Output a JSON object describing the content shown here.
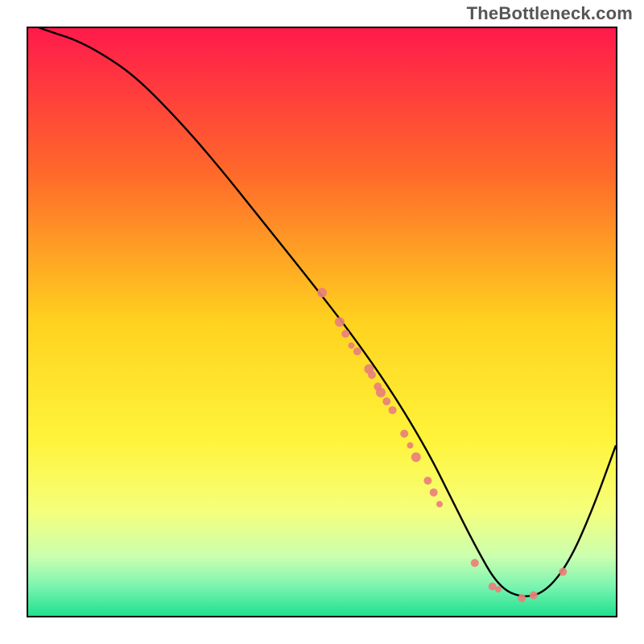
{
  "attribution": "TheBottleneck.com",
  "chart_data": {
    "type": "line",
    "title": "",
    "xlabel": "",
    "ylabel": "",
    "xlim": [
      0,
      100
    ],
    "ylim": [
      0,
      100
    ],
    "gradient_stops": [
      {
        "offset": 0.0,
        "color": "#ff1a4b"
      },
      {
        "offset": 0.25,
        "color": "#ff6a2a"
      },
      {
        "offset": 0.5,
        "color": "#ffd21f"
      },
      {
        "offset": 0.7,
        "color": "#fff43a"
      },
      {
        "offset": 0.82,
        "color": "#f5ff7a"
      },
      {
        "offset": 0.9,
        "color": "#caffb0"
      },
      {
        "offset": 0.95,
        "color": "#7af4b0"
      },
      {
        "offset": 1.0,
        "color": "#1fe08f"
      }
    ],
    "series": [
      {
        "name": "bottleneck-curve",
        "x": [
          0,
          2,
          5,
          8,
          12,
          18,
          25,
          32,
          40,
          48,
          55,
          62,
          68,
          72,
          76,
          80,
          84,
          88,
          92,
          96,
          100
        ],
        "y": [
          101,
          100,
          99,
          98,
          96,
          92,
          85,
          77,
          67,
          57,
          48,
          38,
          28,
          20,
          12,
          5,
          3,
          4,
          9,
          18,
          29
        ]
      }
    ],
    "markers": [
      {
        "x": 50,
        "y": 55,
        "r": 6
      },
      {
        "x": 53,
        "y": 50,
        "r": 6
      },
      {
        "x": 54,
        "y": 48,
        "r": 5
      },
      {
        "x": 55,
        "y": 46,
        "r": 4
      },
      {
        "x": 56,
        "y": 45,
        "r": 5
      },
      {
        "x": 58,
        "y": 42,
        "r": 6
      },
      {
        "x": 58.5,
        "y": 41,
        "r": 5
      },
      {
        "x": 59.5,
        "y": 39,
        "r": 5
      },
      {
        "x": 60,
        "y": 38,
        "r": 6
      },
      {
        "x": 61,
        "y": 36.5,
        "r": 5
      },
      {
        "x": 62,
        "y": 35,
        "r": 5
      },
      {
        "x": 64,
        "y": 31,
        "r": 5
      },
      {
        "x": 65,
        "y": 29,
        "r": 4
      },
      {
        "x": 66,
        "y": 27,
        "r": 6
      },
      {
        "x": 68,
        "y": 23,
        "r": 5
      },
      {
        "x": 69,
        "y": 21,
        "r": 5
      },
      {
        "x": 70,
        "y": 19,
        "r": 4
      },
      {
        "x": 76,
        "y": 9,
        "r": 5
      },
      {
        "x": 79,
        "y": 5,
        "r": 5
      },
      {
        "x": 80,
        "y": 4.5,
        "r": 4
      },
      {
        "x": 84,
        "y": 3,
        "r": 5
      },
      {
        "x": 86,
        "y": 3.5,
        "r": 5
      },
      {
        "x": 91,
        "y": 7.5,
        "r": 5
      }
    ],
    "marker_color": "#e98079"
  }
}
